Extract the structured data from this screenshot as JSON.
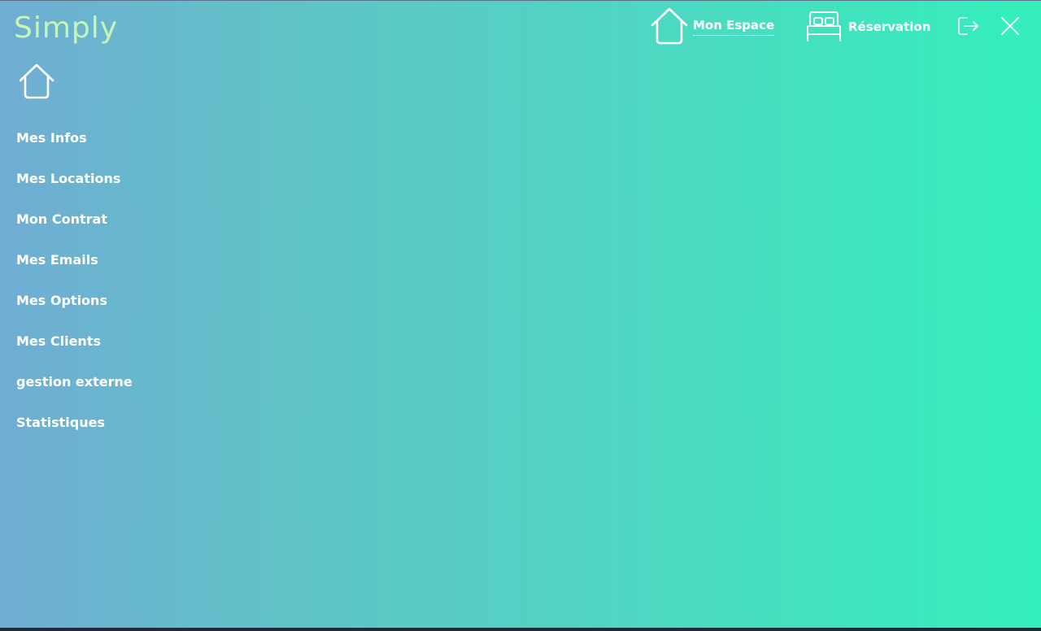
{
  "app": {
    "brand": "Simply"
  },
  "topnav": {
    "mon_espace": "Mon Espace",
    "reservation": "Réservation"
  },
  "sidebar": {
    "items": [
      {
        "label": "Mes Infos"
      },
      {
        "label": "Mes Locations"
      },
      {
        "label": "Mon Contrat"
      },
      {
        "label": "Mes Emails"
      },
      {
        "label": "Mes Options"
      },
      {
        "label": "Mes Clients"
      },
      {
        "label": "gestion externe"
      },
      {
        "label": "Statistiques"
      }
    ]
  },
  "icons": {
    "home": "home-icon",
    "bed": "bed-icon",
    "logout": "logout-icon",
    "close": "close-icon"
  },
  "colors": {
    "gradient_start": "#70add3",
    "gradient_end": "#34efbb",
    "brand": "#c6f5b8",
    "text": "#ffffff"
  }
}
